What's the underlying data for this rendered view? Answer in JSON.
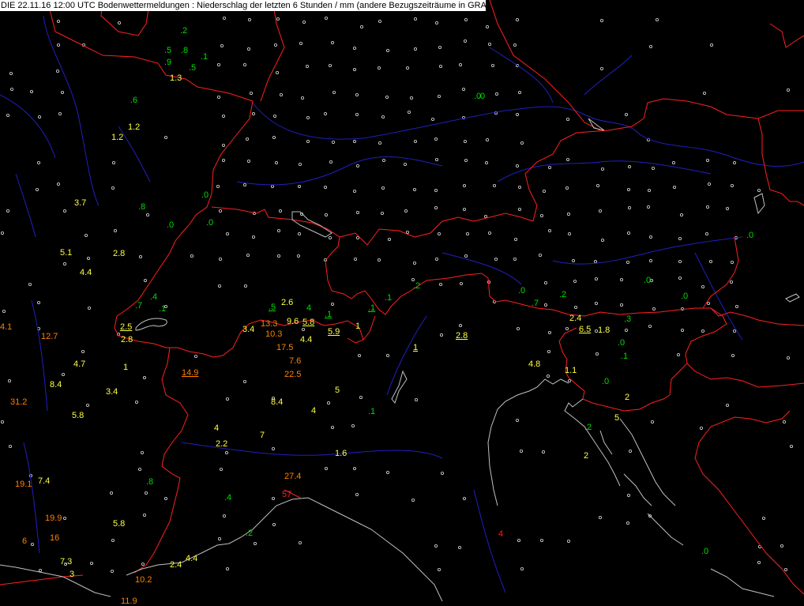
{
  "header": {
    "title": "DIE 22.11.16 12:00 UTC  Bodenwettermeldungen :  Niederschlag der letzten 6 Stunden  / mm (andere Bezugszeiträume in GRAU)"
  },
  "colors": {
    "background": "#000000",
    "border": "#ff2020",
    "river": "#2020c0",
    "coast": "#c0c0c0",
    "station": "#dddddd",
    "green": "#00dd00",
    "yellow": "#ffff40",
    "orange": "#ff8000",
    "red": "#ff2020"
  },
  "observations": [
    {
      "label": ".2",
      "color": "green"
    },
    {
      "label": ".5",
      "color": "green"
    },
    {
      "label": ".8",
      "color": "green"
    },
    {
      "label": ".1",
      "color": "green"
    },
    {
      "label": ".9",
      "color": "green"
    },
    {
      "label": ".5",
      "color": "green"
    },
    {
      "label": "1.3",
      "color": "yellow"
    },
    {
      "label": ".6",
      "color": "green"
    },
    {
      "label": "1.2",
      "color": "yellow"
    },
    {
      "label": "1.2",
      "color": "yellow"
    },
    {
      "label": ".0",
      "color": "green"
    },
    {
      "label": "3.7",
      "color": "yellow"
    },
    {
      "label": ".8",
      "color": "green"
    },
    {
      "label": ".0",
      "color": "green"
    },
    {
      "label": ".0",
      "color": "green"
    },
    {
      "label": "5.1",
      "color": "yellow"
    },
    {
      "label": "2.8",
      "color": "yellow"
    },
    {
      "label": "4.4",
      "color": "yellow"
    },
    {
      "label": ".0",
      "color": "green"
    },
    {
      "label": ".7",
      "color": "green"
    },
    {
      "label": ".4",
      "color": "green"
    },
    {
      "label": ".1",
      "color": "green"
    },
    {
      "label": ".5",
      "color": "green",
      "underline": true
    },
    {
      "label": "2.6",
      "color": "yellow"
    },
    {
      "label": "4",
      "color": "green"
    },
    {
      "label": ".1",
      "color": "green",
      "underline": true
    },
    {
      "label": ".1",
      "color": "green",
      "underline": true
    },
    {
      "label": ".1",
      "color": "green"
    },
    {
      "label": ".2",
      "color": "green"
    },
    {
      "label": "4.1",
      "color": "orange"
    },
    {
      "label": "12.7",
      "color": "orange"
    },
    {
      "label": "2.5",
      "color": "yellow",
      "underline": true
    },
    {
      "label": "2.8",
      "color": "yellow"
    },
    {
      "label": "3.4",
      "color": "yellow"
    },
    {
      "label": "13.3",
      "color": "orange"
    },
    {
      "label": "9.6",
      "color": "yellow"
    },
    {
      "label": "5.8",
      "color": "yellow",
      "underline": true
    },
    {
      "label": "5.9",
      "color": "yellow",
      "underline": true
    },
    {
      "label": "1",
      "color": "yellow"
    },
    {
      "label": "10.3",
      "color": "orange"
    },
    {
      "label": "4.4",
      "color": "yellow"
    },
    {
      "label": "17.5",
      "color": "orange"
    },
    {
      "label": "1",
      "color": "yellow",
      "underline": true
    },
    {
      "label": "2.8",
      "color": "yellow",
      "underline": true
    },
    {
      "label": "4.7",
      "color": "yellow"
    },
    {
      "label": "1",
      "color": "yellow"
    },
    {
      "label": "7.6",
      "color": "orange"
    },
    {
      "label": "14.9",
      "color": "orange",
      "underline": true
    },
    {
      "label": "22.5",
      "color": "orange"
    },
    {
      "label": "4.8",
      "color": "yellow"
    },
    {
      "label": "8.4",
      "color": "yellow"
    },
    {
      "label": "3.4",
      "color": "yellow"
    },
    {
      "label": "5",
      "color": "yellow"
    },
    {
      "label": "31.2",
      "color": "orange"
    },
    {
      "label": "8.4",
      "color": "yellow"
    },
    {
      "label": "4",
      "color": "yellow"
    },
    {
      "label": "5.8",
      "color": "yellow"
    },
    {
      "label": ".1",
      "color": "green"
    },
    {
      "label": "4",
      "color": "yellow"
    },
    {
      "label": "7",
      "color": "yellow"
    },
    {
      "label": "2.2",
      "color": "yellow"
    },
    {
      "label": "1.6",
      "color": "yellow"
    },
    {
      "label": "7.4",
      "color": "yellow"
    },
    {
      "label": "19.1",
      "color": "orange"
    },
    {
      "label": ".8",
      "color": "green"
    },
    {
      "label": "27.4",
      "color": "orange"
    },
    {
      "label": "57",
      "color": "red"
    },
    {
      "label": ".4",
      "color": "green"
    },
    {
      "label": "19.9",
      "color": "orange"
    },
    {
      "label": "5.8",
      "color": "yellow"
    },
    {
      "label": "16",
      "color": "orange"
    },
    {
      "label": "6",
      "color": "orange"
    },
    {
      "label": ".2",
      "color": "green"
    },
    {
      "label": "4",
      "color": "red"
    },
    {
      "label": "7.3",
      "color": "yellow"
    },
    {
      "label": "3",
      "color": "yellow"
    },
    {
      "label": "4.4",
      "color": "yellow"
    },
    {
      "label": "2.4",
      "color": "yellow"
    },
    {
      "label": "10.2",
      "color": "orange"
    },
    {
      "label": "11.9",
      "color": "orange"
    },
    {
      "label": ".0",
      "color": "green"
    },
    {
      "label": ".0",
      "color": "green"
    },
    {
      "label": ".7",
      "color": "green"
    },
    {
      "label": ".2",
      "color": "green"
    },
    {
      "label": ".0",
      "color": "green"
    },
    {
      "label": ".0",
      "color": "green"
    },
    {
      "label": ".0",
      "color": "green"
    },
    {
      "label": "2.4",
      "color": "yellow"
    },
    {
      "label": "6.5",
      "color": "yellow",
      "underline": true
    },
    {
      "label": "1.8",
      "color": "yellow"
    },
    {
      "label": ".3",
      "color": "green"
    },
    {
      "label": ".0",
      "color": "green"
    },
    {
      "label": ".1",
      "color": "green"
    },
    {
      "label": "1.1",
      "color": "yellow"
    },
    {
      "label": ".0",
      "color": "green"
    },
    {
      "label": "2",
      "color": "yellow"
    },
    {
      "label": "5",
      "color": "yellow"
    },
    {
      "label": ".2",
      "color": "green"
    },
    {
      "label": "2",
      "color": "yellow"
    },
    {
      "label": ".0",
      "color": "green"
    }
  ]
}
